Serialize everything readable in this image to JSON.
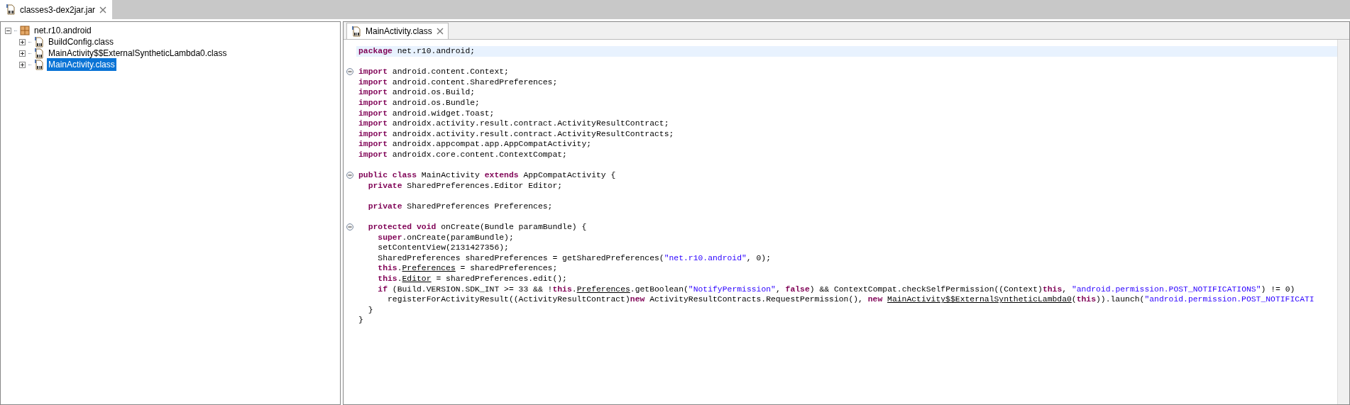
{
  "file_tab": {
    "label": "classes3-dex2jar.jar",
    "selected": true
  },
  "tree": [
    {
      "label": "net.r10.android",
      "kind": "package",
      "expanded": true,
      "selected": false,
      "children": [
        {
          "label": "BuildConfig.class",
          "kind": "class",
          "expanded": false,
          "selected": false
        },
        {
          "label": "MainActivity$$ExternalSyntheticLambda0.class",
          "kind": "class",
          "expanded": false,
          "selected": false
        },
        {
          "label": "MainActivity.class",
          "kind": "class",
          "expanded": false,
          "selected": true
        }
      ]
    }
  ],
  "editor": {
    "tab": {
      "label": "MainActivity.class",
      "selected": true
    },
    "lines": [
      {
        "kind": "code",
        "current": true,
        "tokens": [
          {
            "kind": "keyword",
            "text": "package"
          },
          {
            "kind": "plain",
            "text": " net.r10.android;"
          }
        ]
      },
      {
        "kind": "blank"
      },
      {
        "kind": "foldable",
        "expanded": true,
        "current": false,
        "tokens": [
          {
            "kind": "keyword",
            "text": "import"
          },
          {
            "kind": "plain",
            "text": " android.content.Context;"
          }
        ]
      },
      {
        "kind": "code",
        "current": false,
        "tokens": [
          {
            "kind": "keyword",
            "text": "import"
          },
          {
            "kind": "plain",
            "text": " android.content.SharedPreferences;"
          }
        ]
      },
      {
        "kind": "code",
        "current": false,
        "tokens": [
          {
            "kind": "keyword",
            "text": "import"
          },
          {
            "kind": "plain",
            "text": " android.os.Build;"
          }
        ]
      },
      {
        "kind": "code",
        "current": false,
        "tokens": [
          {
            "kind": "keyword",
            "text": "import"
          },
          {
            "kind": "plain",
            "text": " android.os.Bundle;"
          }
        ]
      },
      {
        "kind": "code",
        "current": false,
        "tokens": [
          {
            "kind": "keyword",
            "text": "import"
          },
          {
            "kind": "plain",
            "text": " android.widget.Toast;"
          }
        ]
      },
      {
        "kind": "code",
        "current": false,
        "tokens": [
          {
            "kind": "keyword",
            "text": "import"
          },
          {
            "kind": "plain",
            "text": " androidx.activity.result.contract.ActivityResultContract;"
          }
        ]
      },
      {
        "kind": "code",
        "current": false,
        "tokens": [
          {
            "kind": "keyword",
            "text": "import"
          },
          {
            "kind": "plain",
            "text": " androidx.activity.result.contract.ActivityResultContracts;"
          }
        ]
      },
      {
        "kind": "code",
        "current": false,
        "tokens": [
          {
            "kind": "keyword",
            "text": "import"
          },
          {
            "kind": "plain",
            "text": " androidx.appcompat.app.AppCompatActivity;"
          }
        ]
      },
      {
        "kind": "code",
        "current": false,
        "tokens": [
          {
            "kind": "keyword",
            "text": "import"
          },
          {
            "kind": "plain",
            "text": " androidx.core.content.ContextCompat;"
          }
        ]
      },
      {
        "kind": "blank"
      },
      {
        "kind": "foldable",
        "expanded": true,
        "current": false,
        "tokens": [
          {
            "kind": "keyword",
            "text": "public class"
          },
          {
            "kind": "plain",
            "text": " MainActivity "
          },
          {
            "kind": "keyword",
            "text": "extends"
          },
          {
            "kind": "plain",
            "text": " AppCompatActivity {"
          }
        ]
      },
      {
        "kind": "code",
        "current": false,
        "tokens": [
          {
            "kind": "keyword",
            "text": "  private"
          },
          {
            "kind": "plain",
            "text": " SharedPreferences.Editor Editor;"
          }
        ]
      },
      {
        "kind": "blank"
      },
      {
        "kind": "code",
        "current": false,
        "tokens": [
          {
            "kind": "keyword",
            "text": "  private"
          },
          {
            "kind": "plain",
            "text": " SharedPreferences Preferences;"
          }
        ]
      },
      {
        "kind": "blank"
      },
      {
        "kind": "foldable",
        "expanded": true,
        "current": false,
        "tokens": [
          {
            "kind": "keyword",
            "text": "  protected void"
          },
          {
            "kind": "plain",
            "text": " onCreate(Bundle paramBundle) {"
          }
        ]
      },
      {
        "kind": "code",
        "current": false,
        "tokens": [
          {
            "kind": "keyword",
            "text": "    super"
          },
          {
            "kind": "plain",
            "text": ".onCreate(paramBundle);"
          }
        ]
      },
      {
        "kind": "code",
        "current": false,
        "tokens": [
          {
            "kind": "plain",
            "text": "    setContentView(2131427356);"
          }
        ]
      },
      {
        "kind": "code",
        "current": false,
        "tokens": [
          {
            "kind": "plain",
            "text": "    SharedPreferences sharedPreferences = getSharedPreferences("
          },
          {
            "kind": "string",
            "text": "\"net.r10.android\""
          },
          {
            "kind": "plain",
            "text": ", 0);"
          }
        ]
      },
      {
        "kind": "code",
        "current": false,
        "tokens": [
          {
            "kind": "keyword",
            "text": "    this"
          },
          {
            "kind": "plain",
            "text": "."
          },
          {
            "kind": "link",
            "text": "Preferences"
          },
          {
            "kind": "plain",
            "text": " = sharedPreferences;"
          }
        ]
      },
      {
        "kind": "code",
        "current": false,
        "tokens": [
          {
            "kind": "keyword",
            "text": "    this"
          },
          {
            "kind": "plain",
            "text": "."
          },
          {
            "kind": "link",
            "text": "Editor"
          },
          {
            "kind": "plain",
            "text": " = sharedPreferences.edit();"
          }
        ]
      },
      {
        "kind": "code",
        "current": false,
        "tokens": [
          {
            "kind": "keyword",
            "text": "    if"
          },
          {
            "kind": "plain",
            "text": " (Build.VERSION.SDK_INT >= 33 && !"
          },
          {
            "kind": "keyword",
            "text": "this"
          },
          {
            "kind": "plain",
            "text": "."
          },
          {
            "kind": "link",
            "text": "Preferences"
          },
          {
            "kind": "plain",
            "text": ".getBoolean("
          },
          {
            "kind": "string",
            "text": "\"NotifyPermission\""
          },
          {
            "kind": "plain",
            "text": ", "
          },
          {
            "kind": "keyword",
            "text": "false"
          },
          {
            "kind": "plain",
            "text": ") && ContextCompat.checkSelfPermission((Context)"
          },
          {
            "kind": "keyword",
            "text": "this"
          },
          {
            "kind": "plain",
            "text": ", "
          },
          {
            "kind": "string",
            "text": "\"android.permission.POST_NOTIFICATIONS\""
          },
          {
            "kind": "plain",
            "text": ") != 0)"
          }
        ]
      },
      {
        "kind": "code",
        "current": false,
        "tokens": [
          {
            "kind": "plain",
            "text": "      registerForActivityResult((ActivityResultContract)"
          },
          {
            "kind": "keyword",
            "text": "new"
          },
          {
            "kind": "plain",
            "text": " ActivityResultContracts.RequestPermission(), "
          },
          {
            "kind": "keyword",
            "text": "new "
          },
          {
            "kind": "link",
            "text": "MainActivity$$ExternalSyntheticLambda0"
          },
          {
            "kind": "plain",
            "text": "("
          },
          {
            "kind": "keyword",
            "text": "this"
          },
          {
            "kind": "plain",
            "text": ")).launch("
          },
          {
            "kind": "string",
            "text": "\"android.permission.POST_NOTIFICATI"
          }
        ]
      },
      {
        "kind": "code",
        "current": false,
        "tokens": [
          {
            "kind": "plain",
            "text": "  }"
          }
        ]
      },
      {
        "kind": "code",
        "current": false,
        "tokens": [
          {
            "kind": "plain",
            "text": "}"
          }
        ]
      }
    ]
  }
}
